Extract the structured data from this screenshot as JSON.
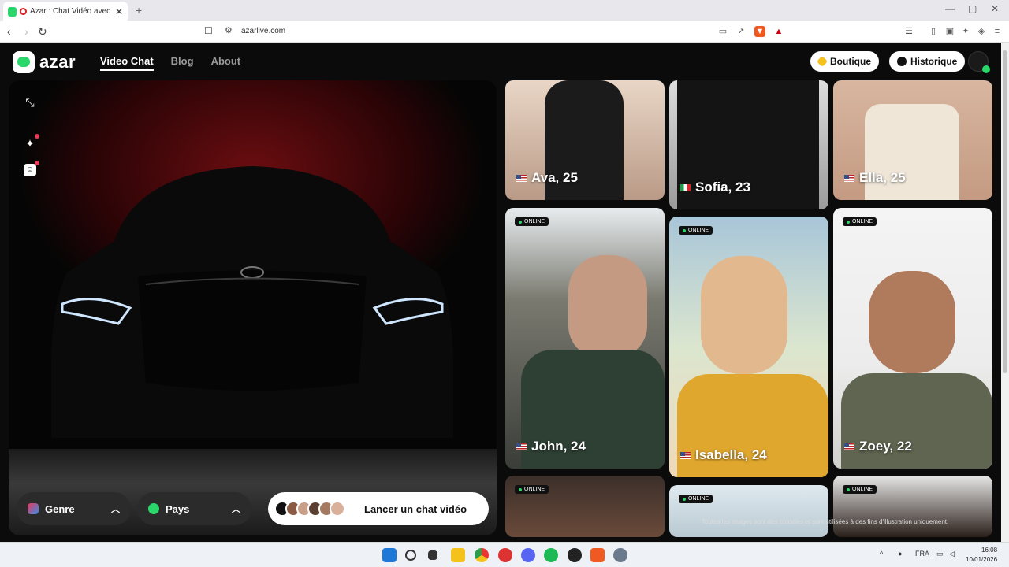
{
  "browser": {
    "tab_title": "Azar : Chat Vidéo avec de no",
    "tab_close": "✕",
    "new_tab": "+",
    "url": "azarlive.com",
    "window_controls": [
      "—",
      "▢",
      "✕"
    ]
  },
  "site": {
    "logo_text": "azar",
    "nav": [
      {
        "label": "Video Chat",
        "active": true
      },
      {
        "label": "Blog",
        "active": false
      },
      {
        "label": "About",
        "active": false
      }
    ],
    "boutique_label": "Boutique",
    "historique_label": "Historique",
    "accent_color": "#2bd66a"
  },
  "video_panel": {
    "genre_label": "Genre",
    "pays_label": "Pays",
    "start_label": "Lancer un chat vidéo",
    "icons": [
      "minimize-icon",
      "sparkle-icon",
      "sticker-icon"
    ]
  },
  "cards": [
    {
      "name": "Ava, 25",
      "flag": "us",
      "online": false
    },
    {
      "name": "Sofia, 23",
      "flag": "it",
      "online": false
    },
    {
      "name": "Ella, 25",
      "flag": "us",
      "online": false
    },
    {
      "name": "John, 24",
      "flag": "us",
      "online": true
    },
    {
      "name": "Isabella, 24",
      "flag": "us",
      "online": true
    },
    {
      "name": "Zoey, 22",
      "flag": "us",
      "online": true
    },
    {
      "name": "",
      "flag": "",
      "online": true
    },
    {
      "name": "",
      "flag": "",
      "online": true
    },
    {
      "name": "",
      "flag": "",
      "online": true
    }
  ],
  "online_label": "ONLINE",
  "disclaimer": "Toutes les images sont des modèles et sont utilisées à des fins d'illustration uniquement.",
  "taskbar": {
    "lang": "FRA",
    "time": "16:08",
    "date": "10/01/2026"
  }
}
